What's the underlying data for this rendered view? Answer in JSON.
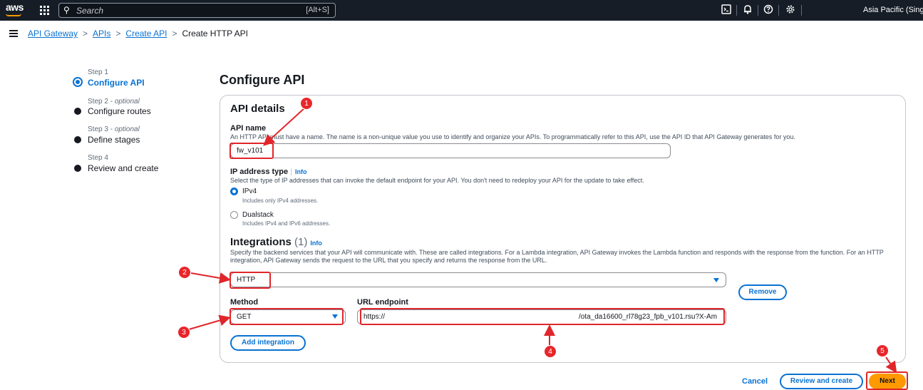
{
  "topbar": {
    "logo": "aws",
    "search_placeholder": "Search",
    "search_shortcut": "[Alt+S]",
    "icons": [
      "grid-icon",
      "search-icon",
      "cloudshell-icon",
      "bell-icon",
      "help-icon",
      "gear-icon"
    ],
    "region": "Asia Pacific (Singapore)"
  },
  "breadcrumb": {
    "items": [
      "API Gateway",
      "APIs",
      "Create API"
    ],
    "current": "Create HTTP API",
    "separator": ">"
  },
  "steps": [
    {
      "label": "Step 1",
      "optional": "",
      "title": "Configure API"
    },
    {
      "label": "Step 2",
      "optional": "optional",
      "title": "Configure routes"
    },
    {
      "label": "Step 3",
      "optional": "optional",
      "title": "Define stages"
    },
    {
      "label": "Step 4",
      "optional": "",
      "title": "Review and create"
    }
  ],
  "page_title": "Configure API",
  "api_details": {
    "heading": "API details",
    "api_name_label": "API name",
    "api_name_desc": "An HTTP API must have a name. The name is a non-unique value you use to identify and organize your APIs. To programmatically refer to this API, use the API ID that API Gateway generates for you.",
    "api_name_value": "fw_v101",
    "ip_type_label": "IP address type",
    "info": "Info",
    "ip_type_desc": "Select the type of IP addresses that can invoke the default endpoint for your API. You don't need to redeploy your API for the update to take effect.",
    "ip_options": [
      {
        "label": "IPv4",
        "desc": "Includes only IPv4 addresses."
      },
      {
        "label": "Dualstack",
        "desc": "Includes IPv4 and IPv6 addresses."
      }
    ]
  },
  "integrations": {
    "heading": "Integrations",
    "count": "(1)",
    "info": "Info",
    "desc": "Specify the backend services that your API will communicate with. These are called integrations. For a Lambda integration, API Gateway invokes the Lambda function and responds with the response from the function. For an HTTP integration, API Gateway sends the request to the URL that you specify and returns the response from the URL.",
    "type_value": "HTTP",
    "remove_label": "Remove",
    "method_label": "Method",
    "method_value": "GET",
    "url_label": "URL endpoint",
    "url_prefix": "https://",
    "url_suffix": "/ota_da16600_rl78g23_fpb_v101.rsu?X-Am",
    "add_label": "Add integration"
  },
  "footer": {
    "cancel": "Cancel",
    "review": "Review and create",
    "next": "Next"
  },
  "markers": [
    "1",
    "2",
    "3",
    "4",
    "5"
  ],
  "colors": {
    "accent": "#0972d3",
    "primary_button": "#ff9900",
    "annotation": "#e0262a",
    "topbar": "#161d26"
  }
}
